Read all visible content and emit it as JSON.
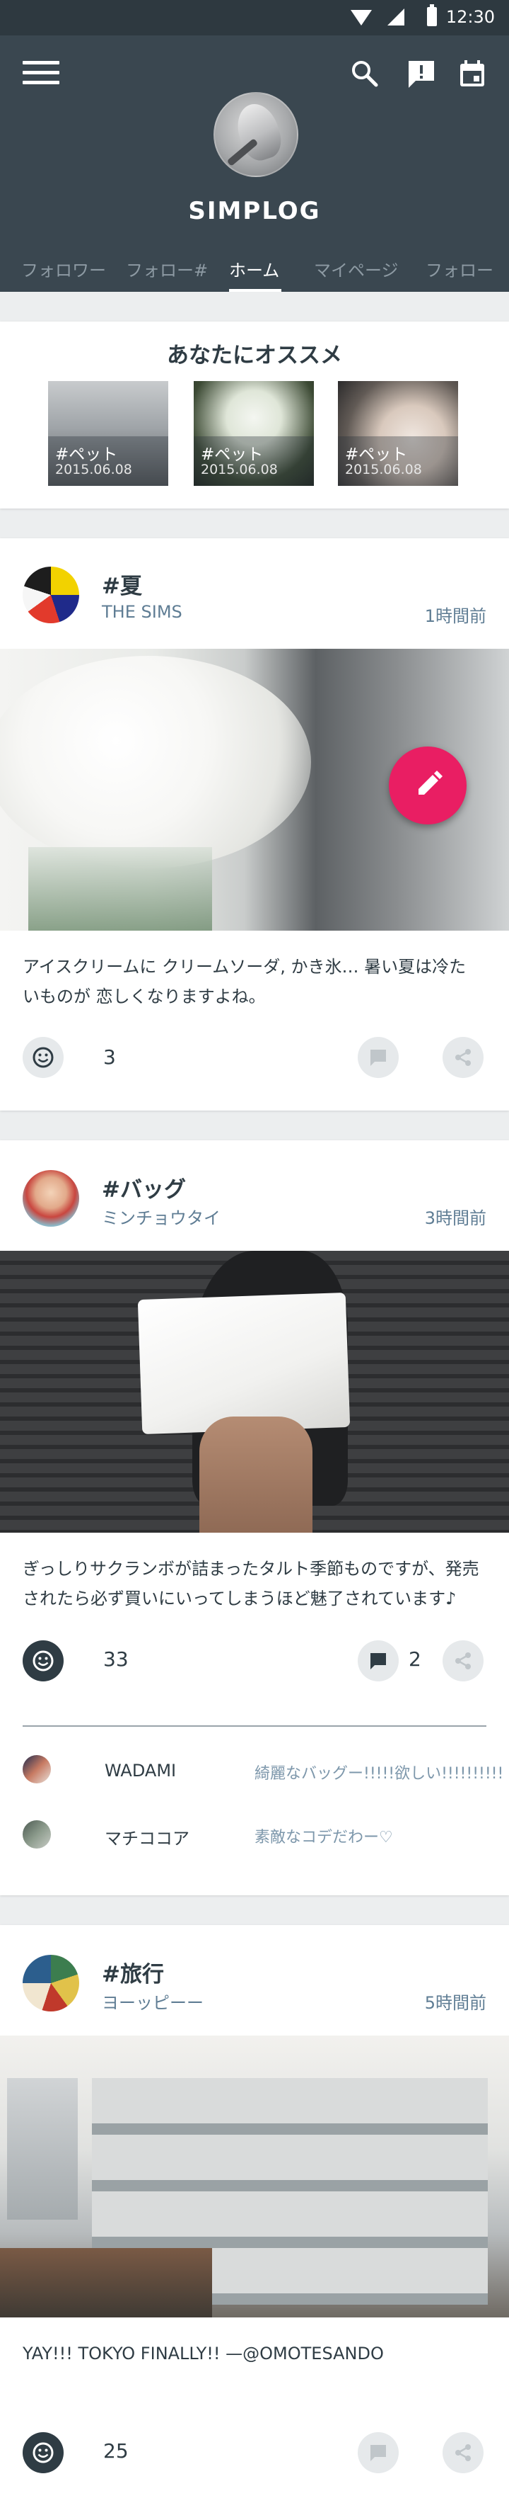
{
  "status_bar": {
    "time": "12:30"
  },
  "header": {
    "app_title": "SIMPLOG",
    "tabs": [
      "フォロワー",
      "フォロー#",
      "ホーム",
      "マイページ",
      "フォロー"
    ],
    "active_tab": "ホーム"
  },
  "recommend": {
    "title": "あなたにオススメ",
    "items": [
      {
        "tag": "#ペット",
        "date": "2015.06.08"
      },
      {
        "tag": "#ペット",
        "date": "2015.06.08"
      },
      {
        "tag": "#ペット",
        "date": "2015.06.08"
      }
    ]
  },
  "posts": [
    {
      "tag": "#夏",
      "user": "THE SIMS",
      "time": "1時間前",
      "text_lines": [
        "アイスクリームに クリームソーダ, かき氷… 暑い夏は冷た",
        "いものが 恋しくなりますよね。"
      ],
      "likes": "3",
      "comments": "",
      "liked": false
    },
    {
      "tag": "#バッグ",
      "user": "ミンチョウタイ",
      "time": "3時間前",
      "text_lines": [
        "ぎっしりサクランボが詰まったタルト季節ものですが、発売",
        "されたら必ず買いにいってしまうほど魅了されています♪"
      ],
      "likes": "33",
      "comments": "2",
      "liked": true,
      "comment_list": [
        {
          "name": "WADAMI",
          "text": "綺麗なバッグー!!!!!欲しい!!!!!!!!!!"
        },
        {
          "name": "マチココア",
          "text": "素敵なコデだわー♡"
        }
      ]
    },
    {
      "tag": "#旅行",
      "user": "ヨーッピーー",
      "time": "5時間前",
      "text_lines": [
        "YAY!!! TOKYO FINALLY!! —@OMOTESANDO"
      ],
      "likes": "25",
      "comments": "",
      "liked": true
    }
  ],
  "colors": {
    "header_bg": "#3a4750",
    "accent_fab": "#e91e63",
    "text_primary": "#2f3c44",
    "text_secondary": "#5f7d94"
  },
  "icons": {
    "header": [
      "menu-icon",
      "search-icon",
      "alert-icon",
      "calendar-icon"
    ],
    "fab": "edit-icon",
    "actions": [
      "smiley-icon",
      "comment-icon",
      "share-icon"
    ]
  }
}
